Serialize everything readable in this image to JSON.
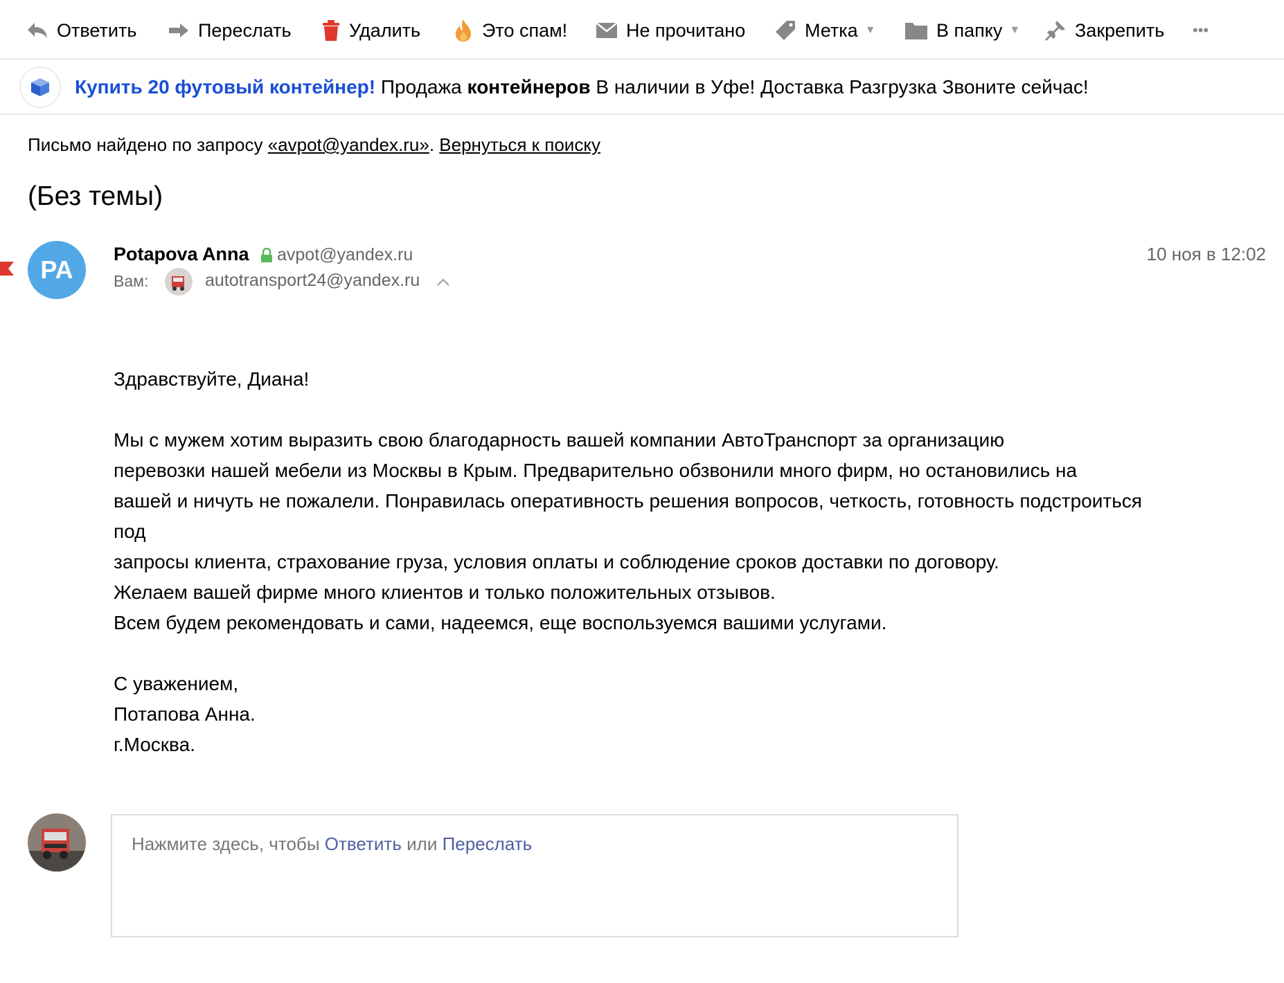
{
  "toolbar": {
    "reply": "Ответить",
    "forward": "Переслать",
    "delete": "Удалить",
    "spam": "Это спам!",
    "unread": "Не прочитано",
    "label": "Метка",
    "folder": "В папку",
    "pin": "Закрепить",
    "more": "•••"
  },
  "ad": {
    "link": "Купить 20 футовый контейнер!",
    "text_1": "Продажа",
    "bold": "контейнеров",
    "text_2": "В наличии в Уфе! Доставка Разгрузка Звоните сейчас!"
  },
  "search_notice": {
    "prefix": "Письмо найдено по запросу",
    "query": "«avpot@yandex.ru»",
    "separator": ".",
    "back_link": "Вернуться к поиску"
  },
  "message": {
    "subject": "(Без темы)",
    "sender_initials": "PA",
    "sender_name": "Potapova Anna",
    "sender_email": "avpot@yandex.ru",
    "to_label": "Вам:",
    "to_email": "autotransport24@yandex.ru",
    "date": "10 ноя в 12:02",
    "body_lines": [
      "Здравствуйте, Диана!",
      "",
      "Мы с мужем хотим выразить свою благодарность вашей компании АвтоТранспорт за организацию",
      "перевозки нашей мебели из Москвы в Крым. Предварительно обзвонили много фирм, но остановились на",
      "вашей и ничуть не пожалели. Понравилась оперативность решения вопросов, четкость, готовность подстроиться",
      "под",
      "запросы клиента, страхование груза, условия оплаты и соблюдение сроков доставки по договору.",
      "Желаем вашей фирме много клиентов и только положительных отзывов.",
      "Всем будем рекомендовать и сами, надеемся, еще воспользуемся вашими услугами.",
      "",
      "С уважением,",
      "Потапова Анна.",
      "г.Москва."
    ]
  },
  "reply_box": {
    "hint_prefix": "Нажмите здесь, чтобы",
    "reply_link": "Ответить",
    "or": "или",
    "forward_link": "Переслать"
  },
  "colors": {
    "ad_link": "#1a4fd6",
    "avatar_bg": "#52a8e6",
    "flag": "#e0382d",
    "reply_link": "#4f5fa0"
  }
}
